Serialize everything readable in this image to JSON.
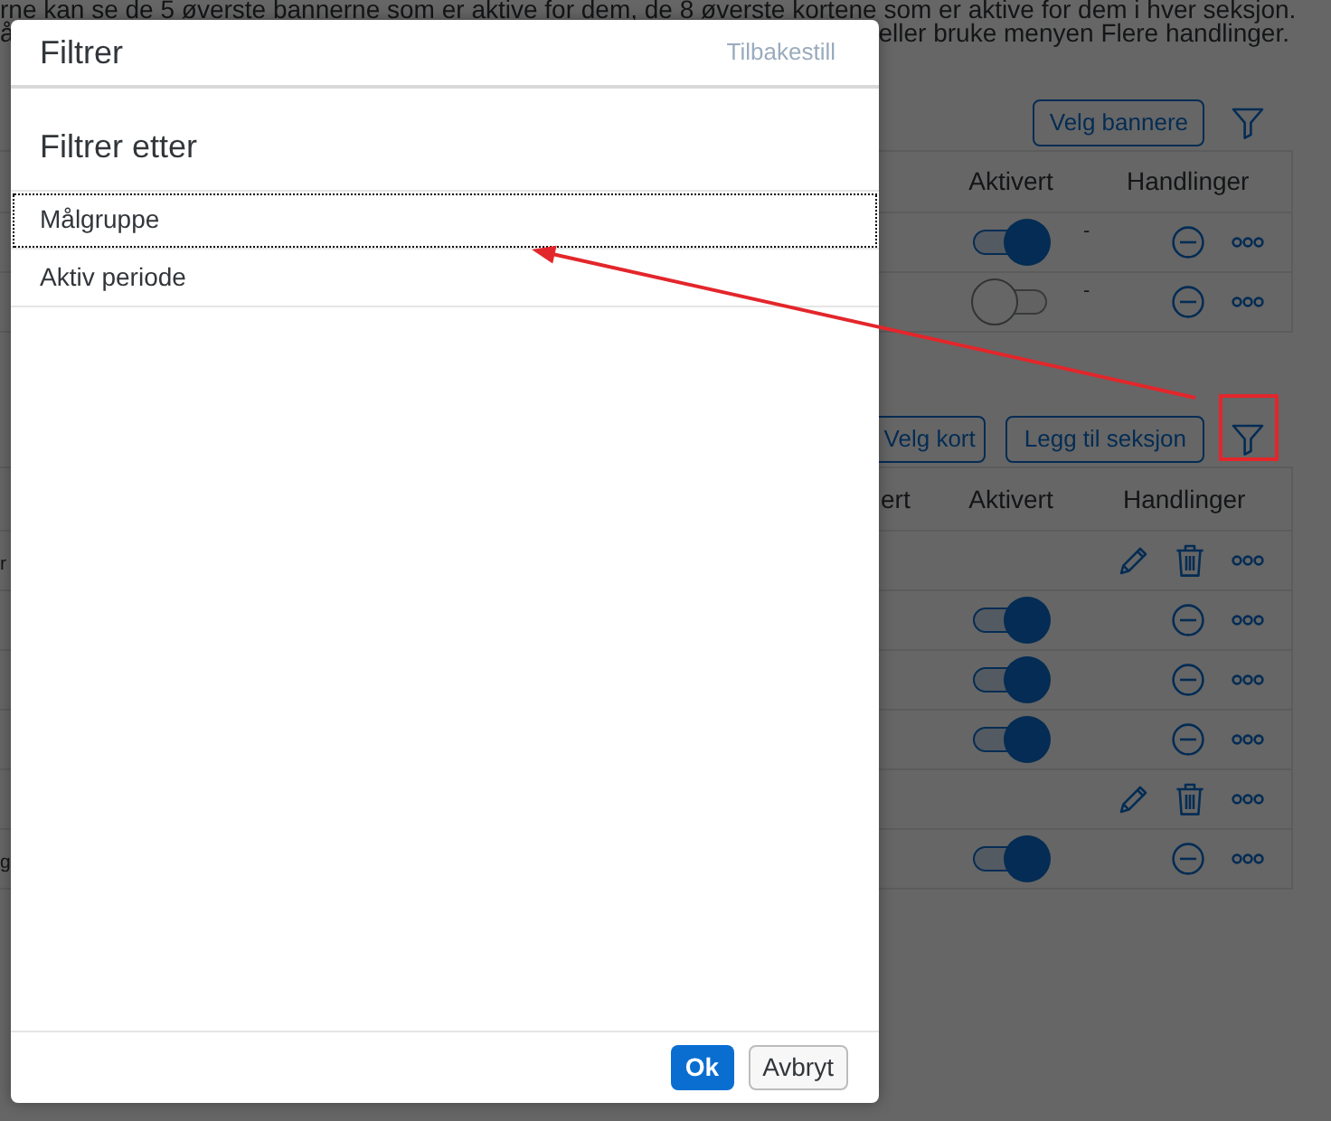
{
  "background_page": {
    "intro": {
      "line_1": "rne kan se de 5 øverste bannerne som er aktive for dem, de 8 øverste kortene som er aktive for dem i hver seksjon.",
      "line_2_start": "å",
      "line_2_end": "eller bruke menyen Flere handlinger."
    },
    "banner_section": {
      "buttons": [
        "Velg bannere"
      ],
      "table": {
        "columns": [
          "Aktivert",
          "Handlinger"
        ],
        "rows": [
          {
            "kind": "toggle",
            "on": true,
            "unlabeled_column": "-"
          },
          {
            "kind": "toggle",
            "on": false,
            "unlabeled_column": "-"
          }
        ]
      }
    },
    "card_section": {
      "buttons": [
        "Velg kort",
        "Legg til seksjon"
      ],
      "table": {
        "columns": [
          "ert",
          "Aktivert",
          "Handlinger"
        ],
        "rows": [
          {
            "kind": "edit",
            "column_1": "r"
          },
          {
            "kind": "toggle",
            "on": true
          },
          {
            "kind": "toggle",
            "on": true
          },
          {
            "kind": "toggle",
            "on": true
          },
          {
            "kind": "edit"
          },
          {
            "kind": "toggle",
            "on": true,
            "column_1": "g"
          }
        ]
      }
    }
  },
  "dialog": {
    "title": "Filtrer",
    "reset": {
      "label": "Tilbakestill",
      "disabled": true
    },
    "heading": "Filtrer etter",
    "items": [
      {
        "label": "Målgruppe",
        "focused": true
      },
      {
        "label": "Aktiv periode",
        "focused": false
      }
    ],
    "buttons": [
      {
        "label": "Ok",
        "kind": "primary"
      },
      {
        "label": "Avbryt",
        "kind": "secondary"
      }
    ]
  }
}
